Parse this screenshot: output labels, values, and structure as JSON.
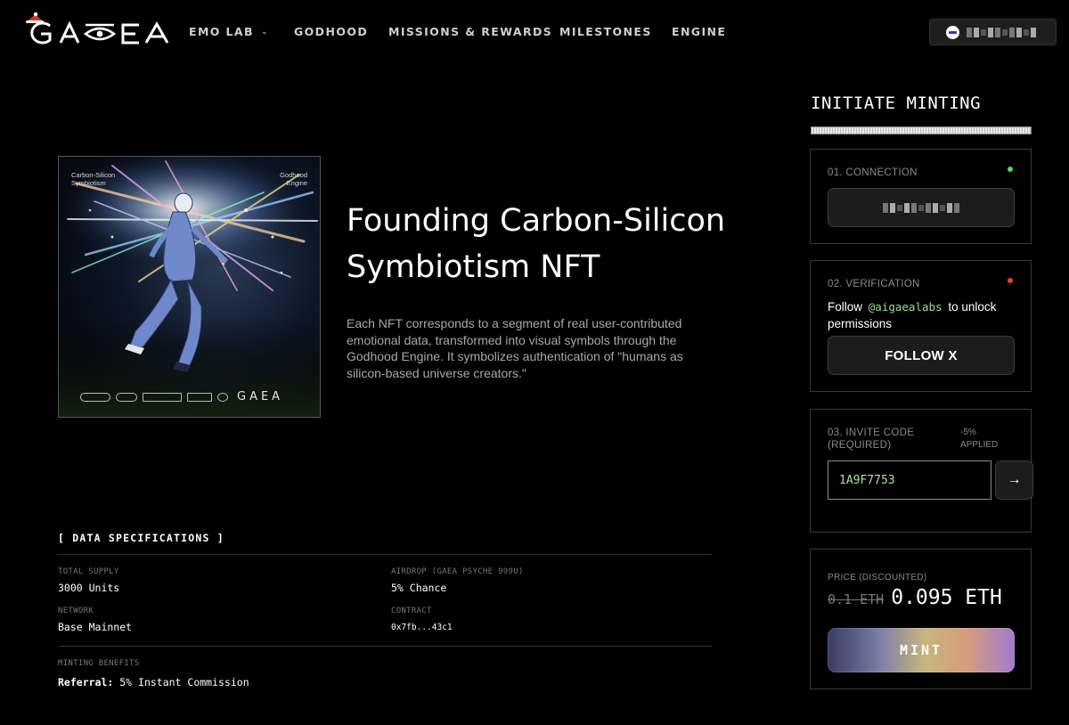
{
  "header": {
    "brand": "GAEA",
    "nav": [
      {
        "label": "EMO LAB",
        "has_dropdown": true
      },
      {
        "label": "GODHOOD"
      },
      {
        "label": "MISSIONS & REWARDS"
      },
      {
        "label": "MILESTONES"
      },
      {
        "label": "ENGINE"
      }
    ]
  },
  "artwork": {
    "label_left": "Carbon-Silicon\nSymbiotism",
    "label_right": "Godhood\nEngine",
    "brand": "GAEA"
  },
  "hero": {
    "title": "Founding Carbon-Silicon Symbiotism NFT",
    "description": "Each NFT corresponds to a segment of real user-contributed emotional data, transformed into visual symbols through the Godhood Engine. It symbolizes authentication of \"humans as silicon-based universe creators.\""
  },
  "specs": {
    "title": "[ DATA SPECIFICATIONS ]",
    "total_supply": {
      "label": "TOTAL SUPPLY",
      "value": "3000 Units"
    },
    "airdrop": {
      "label": "AIRDROP (GAEA PSYCHE 999U)",
      "value": "5% Chance"
    },
    "network": {
      "label": "NETWORK",
      "value": "Base Mainnet"
    },
    "contract": {
      "label": "CONTRACT",
      "value": "0x7fb...43c1"
    },
    "benefits": {
      "label": "MINTING BENEFITS",
      "key": "Referral:",
      "value": "5% Instant Commission"
    }
  },
  "panel": {
    "title": "INITIATE MINTING",
    "connection": {
      "label": "01. CONNECTION",
      "status_color": "#5fd35f"
    },
    "verification": {
      "label": "02. VERIFICATION",
      "status_color": "#e0442f",
      "text_before": "Follow",
      "handle": "@aigaealabs",
      "text_after": "to unlock permissions",
      "button": "FOLLOW X"
    },
    "invite": {
      "label": "03. INVITE CODE\n(REQUIRED)",
      "discount": "-5%\nAPPLIED",
      "value": "1A9F7753",
      "submit_icon": "arrow-right"
    },
    "price": {
      "label": "PRICE (DISCOUNTED)",
      "original": "0.1 ETH",
      "discounted": "0.095 ETH",
      "mint_label": "MINT"
    }
  },
  "colors": {
    "accent_green": "#9fdc93",
    "status_green": "#5fd35f",
    "status_red": "#e0442f",
    "background": "#000000"
  }
}
